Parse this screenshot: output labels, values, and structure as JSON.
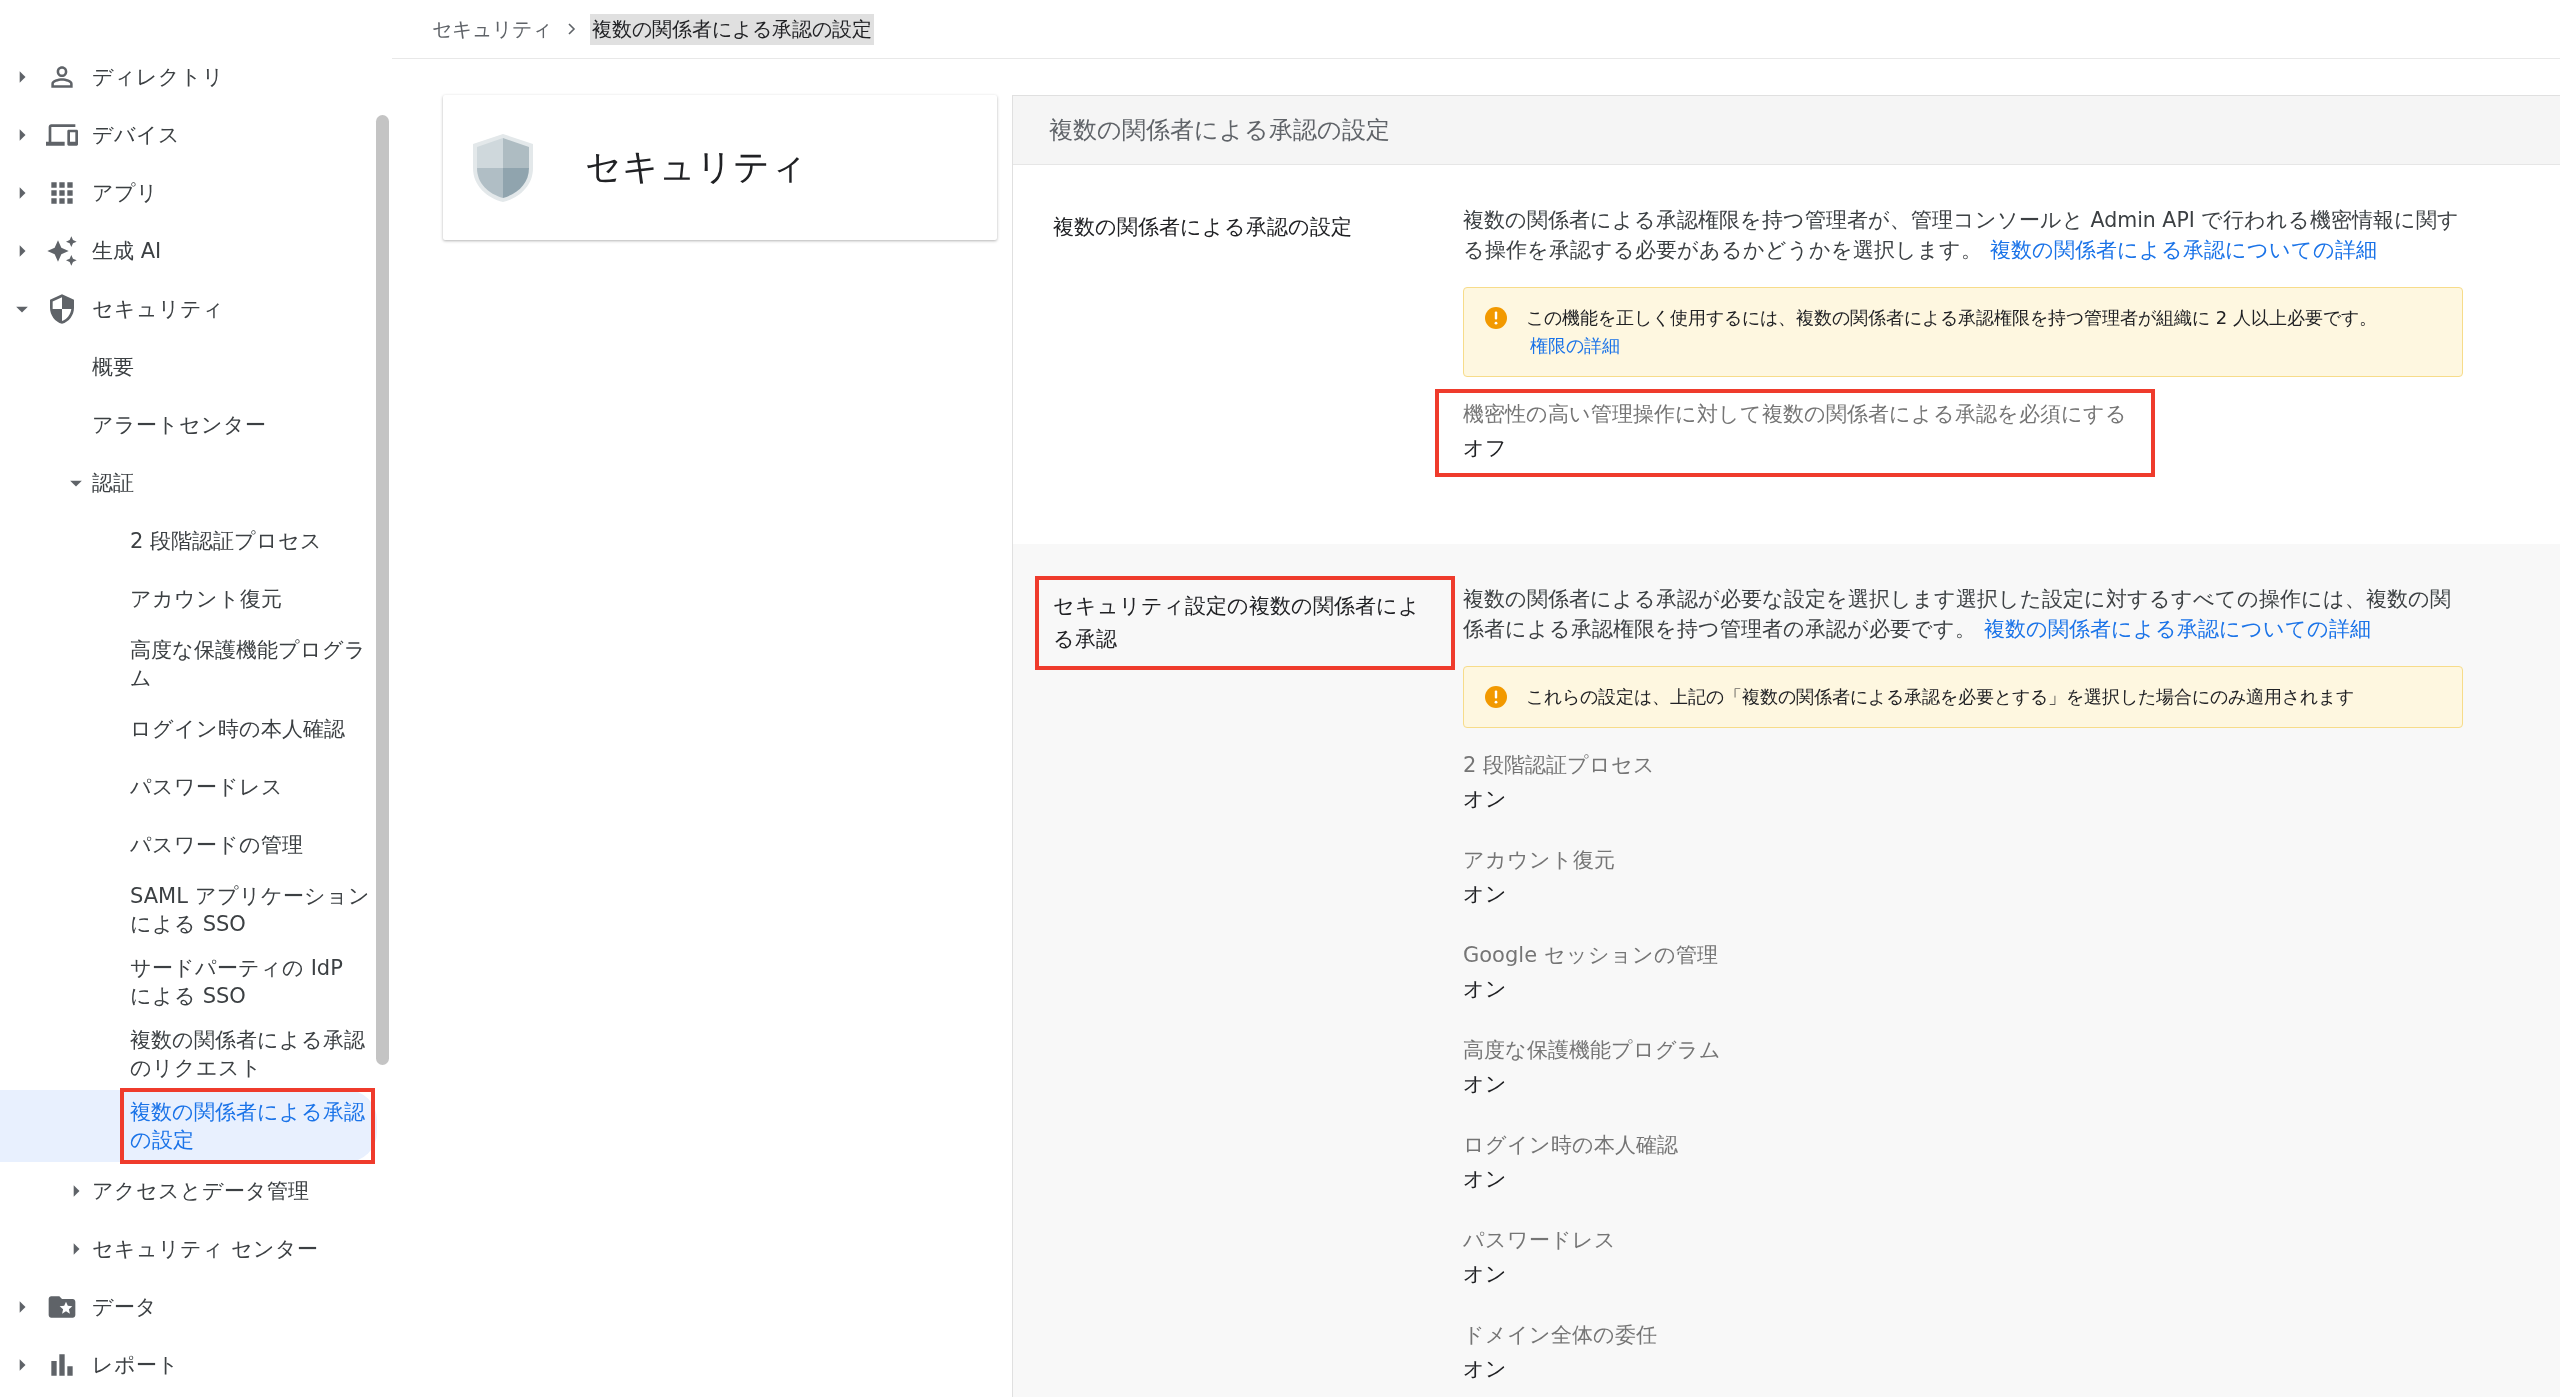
{
  "breadcrumb": {
    "parent": "セキュリティ",
    "current": "複数の関係者による承認の設定"
  },
  "sidebar": {
    "items": [
      {
        "label": "ディレクトリ",
        "expanded": false,
        "selected": false,
        "highlighted": false
      },
      {
        "label": "デバイス",
        "expanded": false,
        "selected": false,
        "highlighted": false
      },
      {
        "label": "アプリ",
        "expanded": false,
        "selected": false,
        "highlighted": false
      },
      {
        "label": "生成 AI",
        "expanded": false,
        "selected": false,
        "highlighted": false
      },
      {
        "label": "セキュリティ",
        "expanded": true,
        "selected": false,
        "highlighted": false,
        "children": [
          {
            "label": "概要",
            "selected": false,
            "highlighted": false
          },
          {
            "label": "アラートセンター",
            "selected": false,
            "highlighted": false
          },
          {
            "label": "認証",
            "expanded": true,
            "selected": false,
            "highlighted": false,
            "children": [
              {
                "label": "2 段階認証プロセス",
                "selected": false,
                "highlighted": false
              },
              {
                "label": "アカウント復元",
                "selected": false,
                "highlighted": false
              },
              {
                "label": "高度な保護機能プログラム",
                "selected": false,
                "highlighted": false
              },
              {
                "label": "ログイン時の本人確認",
                "selected": false,
                "highlighted": false
              },
              {
                "label": "パスワードレス",
                "selected": false,
                "highlighted": false
              },
              {
                "label": "パスワードの管理",
                "selected": false,
                "highlighted": false
              },
              {
                "label": "SAML アプリケーションによる SSO",
                "selected": false,
                "highlighted": false
              },
              {
                "label": "サードパーティの IdP による SSO",
                "selected": false,
                "highlighted": false
              },
              {
                "label": "複数の関係者による承認のリクエスト",
                "selected": false,
                "highlighted": false
              },
              {
                "label": "複数の関係者による承認の設定",
                "selected": true,
                "highlighted": true
              }
            ]
          },
          {
            "label": "アクセスとデータ管理",
            "expanded": false,
            "selected": false,
            "highlighted": false
          },
          {
            "label": "セキュリティ センター",
            "expanded": false,
            "selected": false,
            "highlighted": false
          }
        ]
      },
      {
        "label": "データ",
        "expanded": false,
        "selected": false,
        "highlighted": false
      },
      {
        "label": "レポート",
        "expanded": false,
        "selected": false,
        "highlighted": false
      }
    ]
  },
  "service_card": {
    "title": "セキュリティ"
  },
  "panel": {
    "title": "複数の関係者による承認の設定",
    "sections": [
      {
        "title": "複数の関係者による承認の設定",
        "highlighted": false,
        "description": "複数の関係者による承認権限を持つ管理者が、管理コンソールと Admin API で行われる機密情報に関する操作を承認する必要があるかどうかを選択します。",
        "link": "複数の関係者による承認についての詳細",
        "notice": {
          "text": "この機能を正しく使用するには、複数の関係者による承認権限を持つ管理者が組織に 2 人以上必要です。",
          "link": "権限の詳細"
        },
        "settings": [
          {
            "label": "機密性の高い管理操作に対して複数の関係者による承認を必須にする",
            "value": "オフ",
            "highlighted": true
          }
        ]
      },
      {
        "title": "セキュリティ設定の複数の関係者による承認",
        "highlighted": true,
        "description": "複数の関係者による承認が必要な設定を選択します選択した設定に対するすべての操作には、複数の関係者による承認権限を持つ管理者の承認が必要です。",
        "link": "複数の関係者による承認についての詳細",
        "notice": {
          "text": "これらの設定は、上記の「複数の関係者による承認を必要とする」を選択した場合にのみ適用されます"
        },
        "settings": [
          {
            "label": "2 段階認証プロセス",
            "value": "オン",
            "highlighted": false
          },
          {
            "label": "アカウント復元",
            "value": "オン",
            "highlighted": false
          },
          {
            "label": "Google セッションの管理",
            "value": "オン",
            "highlighted": false
          },
          {
            "label": "高度な保護機能プログラム",
            "value": "オン",
            "highlighted": false
          },
          {
            "label": "ログイン時の本人確認",
            "value": "オン",
            "highlighted": false
          },
          {
            "label": "パスワードレス",
            "value": "オン",
            "highlighted": false
          },
          {
            "label": "ドメイン全体の委任",
            "value": "オン",
            "highlighted": false
          }
        ]
      }
    ]
  }
}
